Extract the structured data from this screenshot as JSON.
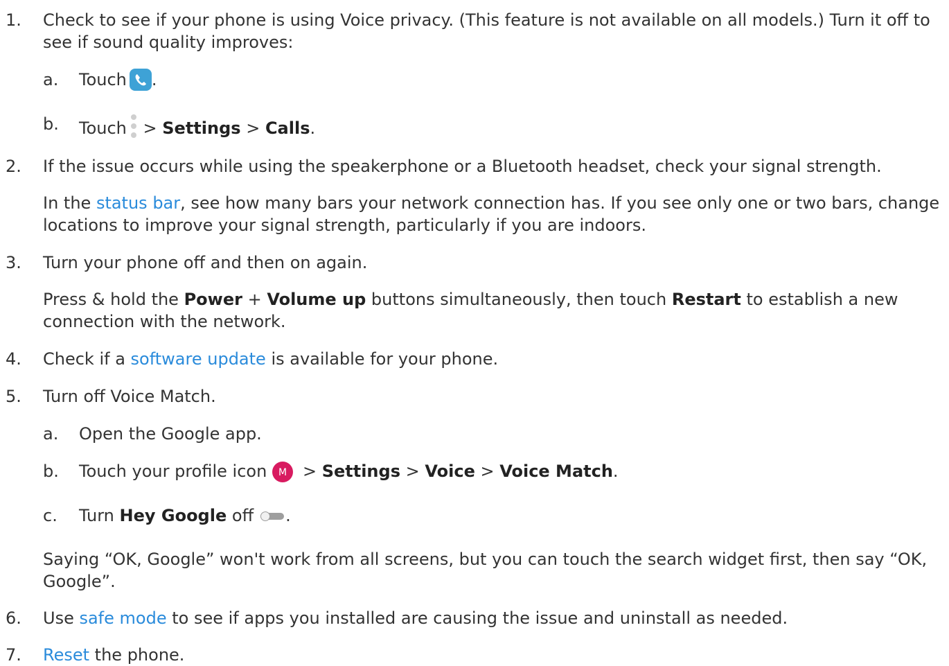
{
  "colors": {
    "link": "#2a8bdb",
    "text": "#333333",
    "phone_icon": "#3ea2d6",
    "avatar": "#d81b60",
    "toggle": "#9e9e9e"
  },
  "steps": [
    {
      "num": "1.",
      "text": "Check to see if your phone is using Voice privacy. (This feature is not available on all models.) Turn it off to see if sound quality improves:"
    },
    {
      "num": "2.",
      "text": "If the issue occurs while using the speakerphone or a Bluetooth headset, check your signal strength.",
      "note_pre": "In the ",
      "note_link": "status bar",
      "note_post": ", see how many bars your network connection has. If you see only one or two bars, change locations to improve your signal strength, particularly if you are indoors."
    },
    {
      "num": "3.",
      "text": "Turn your phone off and then on again.",
      "note_1": "Press & hold the ",
      "note_bold_1": "Power",
      "note_2": " + ",
      "note_bold_2": "Volume up",
      "note_3": " buttons simultaneously, then touch ",
      "note_bold_3": "Restart",
      "note_4": " to establish a new connection with the network."
    },
    {
      "num": "4.",
      "pre": "Check if a ",
      "link": "software update",
      "post": " is available for your phone."
    },
    {
      "num": "5.",
      "text": "Turn off Voice Match.",
      "note": "Saying “OK, Google” won't work from all screens, but you can touch the search widget first, then say “OK, Google”."
    },
    {
      "num": "6.",
      "pre": "Use ",
      "link": "safe mode",
      "post": " to see if apps you installed are causing the issue and uninstall as needed."
    },
    {
      "num": "7.",
      "link": "Reset",
      "post": " the phone."
    }
  ],
  "substeps": {
    "s1a": {
      "label": "a.",
      "text": "Touch",
      "icon": "phone-app-icon",
      "end": "."
    },
    "s1b": {
      "label": "b.",
      "text": "Touch",
      "icon": "more-options-icon",
      "sep1": " > ",
      "bold1": "Settings",
      "sep2": " > ",
      "bold2": "Calls",
      "end": "."
    },
    "s5a": {
      "label": "a.",
      "text": "Open the Google app."
    },
    "s5b": {
      "label": "b.",
      "text": "Touch your profile icon",
      "icon": "profile-avatar-icon",
      "avatar_letter": "M",
      "sep1": " > ",
      "bold1": "Settings",
      "sep2": " > ",
      "bold2": "Voice",
      "sep3": " > ",
      "bold3": "Voice Match",
      "end": "."
    },
    "s5c": {
      "label": "c.",
      "pre": "Turn ",
      "bold": "Hey Google",
      "post": " off",
      "icon": "toggle-off-icon",
      "end": "."
    }
  }
}
